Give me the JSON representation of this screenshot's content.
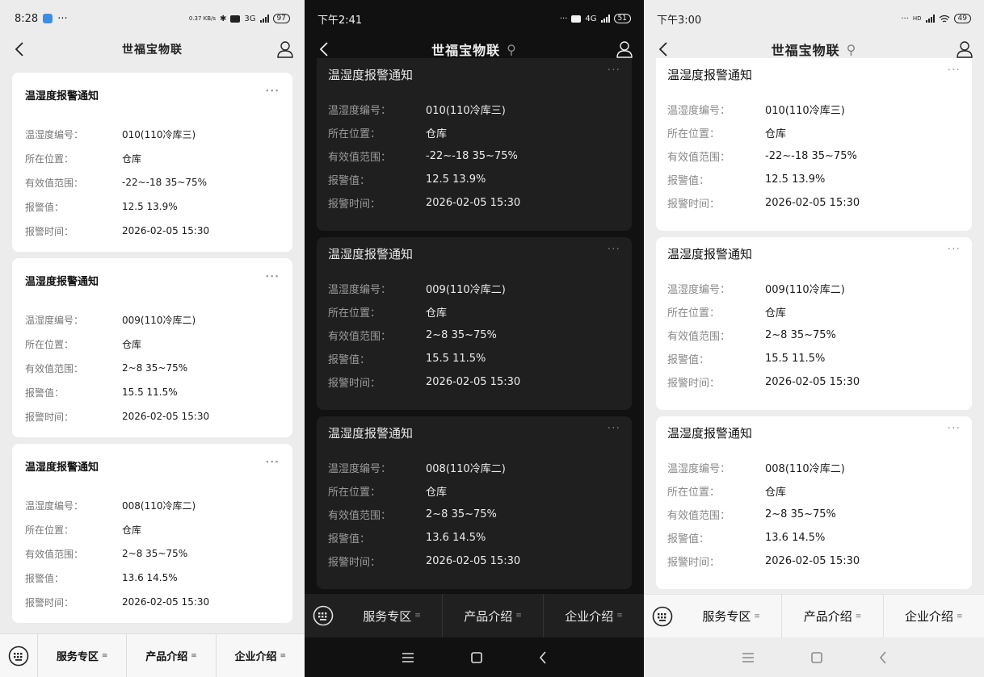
{
  "title": "世福宝物联",
  "tabs": [
    "服务专区",
    "产品介绍",
    "企业介绍"
  ],
  "labels": {
    "code": "温湿度编号：",
    "location": "所在位置：",
    "range": "有效值范围：",
    "alarm": "报警值：",
    "time": "报警时间："
  },
  "cards": [
    {
      "title": "温湿度报警通知",
      "code": "010(110冷库三)",
      "location": "仓库",
      "range": "-22~-18 35~75%",
      "alarm": "12.5   13.9%",
      "time": "2026-02-05 15:30"
    },
    {
      "title": "温湿度报警通知",
      "code": "009(110冷库二)",
      "location": "仓库",
      "range": "2~8 35~75%",
      "alarm": "15.5   11.5%",
      "time": "2026-02-05 15:30"
    },
    {
      "title": "温湿度报警通知",
      "code": "008(110冷库二)",
      "location": "仓库",
      "range": "2~8 35~75%",
      "alarm": "13.6   14.5%",
      "time": "2026-02-05 15:30"
    }
  ],
  "screens": [
    {
      "status_time": "8:28",
      "status_speed": "0.37 KB/s",
      "status_net": "3G",
      "battery": "97"
    },
    {
      "status_time": "下午2:41",
      "status_net": "4G",
      "battery": "51"
    },
    {
      "status_time": "下午3:00",
      "status_net": "HD",
      "battery": "49"
    }
  ],
  "colors": {
    "dark_bg": "#111111",
    "dark_card": "#1f1f1f",
    "light_bg": "#ececec",
    "card_light": "#ffffff"
  }
}
